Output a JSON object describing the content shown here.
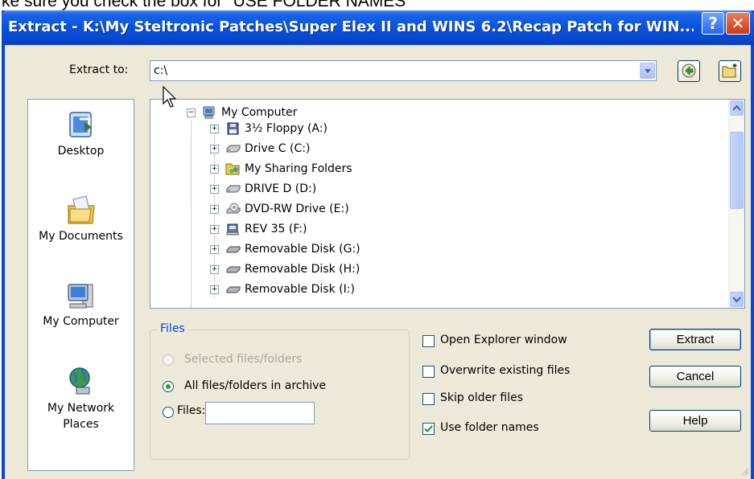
{
  "caption": "ke sure you check the box for \"USE FOLDER NAMES\"",
  "title": "Extract - K:\\My Steltronic Patches\\Super Elex II and WINS 6.2\\Recap Patch for WIN...",
  "titlebar_buttons": {
    "help": "?",
    "close": "✕"
  },
  "extract_to": {
    "label": "Extract to:",
    "value": "c:\\"
  },
  "places": [
    {
      "label": "Desktop",
      "icon": "desktop-icon"
    },
    {
      "label": "My Documents",
      "icon": "my-documents-icon"
    },
    {
      "label": "My Computer",
      "icon": "my-computer-icon"
    },
    {
      "label": "My Network Places",
      "icon": "my-network-places-icon"
    }
  ],
  "tree": {
    "root": "My Computer",
    "items": [
      {
        "label": "3½ Floppy (A:)",
        "icon": "floppy-icon"
      },
      {
        "label": "Drive C (C:)",
        "icon": "drive-icon"
      },
      {
        "label": "My Sharing Folders",
        "icon": "sharing-folder-icon"
      },
      {
        "label": "DRIVE D (D:)",
        "icon": "drive-icon"
      },
      {
        "label": "DVD-RW Drive (E:)",
        "icon": "dvd-icon"
      },
      {
        "label": "REV 35 (F:)",
        "icon": "rev-drive-icon"
      },
      {
        "label": "Removable Disk (G:)",
        "icon": "removable-disk-icon"
      },
      {
        "label": "Removable Disk (H:)",
        "icon": "removable-disk-icon"
      },
      {
        "label": "Removable Disk (I:)",
        "icon": "removable-disk-icon"
      }
    ]
  },
  "files": {
    "legend": "Files",
    "selected": "Selected files/folders",
    "all": "All files/folders in archive",
    "files": "Files:",
    "files_value": ""
  },
  "options": {
    "open_explorer": "Open Explorer window",
    "overwrite": "Overwrite existing files",
    "skip_older": "Skip older files",
    "use_folder_names": "Use folder names"
  },
  "buttons": {
    "extract": "Extract",
    "cancel": "Cancel",
    "help": "Help"
  },
  "colors": {
    "title_blue": "#0a55df",
    "dialog_bg": "#ece9d8",
    "group_legend": "#0046d5",
    "check_green": "#21a121"
  }
}
